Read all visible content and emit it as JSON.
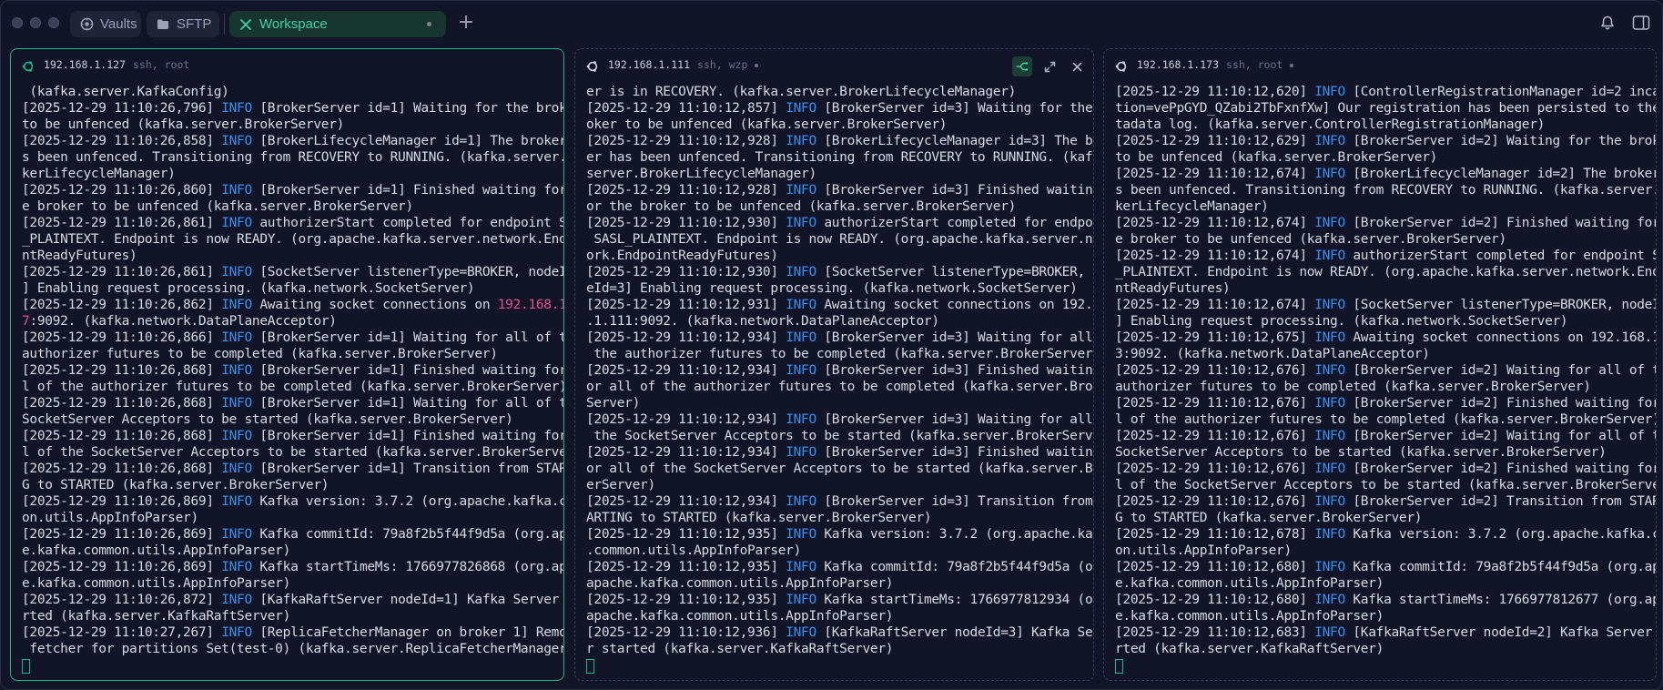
{
  "tabs": [
    {
      "label": "Vaults",
      "icon": "vault-icon"
    },
    {
      "label": "SFTP",
      "icon": "folder-icon"
    },
    {
      "label": "Workspace",
      "icon": "workspace-icon",
      "active": true
    }
  ],
  "colors": {
    "accent": "#1fb585",
    "info": "#3b8ff0",
    "highlight": "#e2508f"
  },
  "panes": [
    {
      "host": "192.168.1.127",
      "conn": "ssh, root",
      "lines": [
        [
          {
            "t": " (kafka.server.KafkaConfig)"
          }
        ],
        [
          {
            "t": "[2025-12-29 11:10:26,796] "
          },
          {
            "t": "INFO",
            "c": "lvl"
          },
          {
            "t": " [BrokerServer id=1] Waiting for the broker"
          }
        ],
        [
          {
            "t": "to be unfenced (kafka.server.BrokerServer)"
          }
        ],
        [
          {
            "t": "[2025-12-29 11:10:26,858] "
          },
          {
            "t": "INFO",
            "c": "lvl"
          },
          {
            "t": " [BrokerLifecycleManager id=1] The broker ha"
          }
        ],
        [
          {
            "t": "s been unfenced. Transitioning from RECOVERY to RUNNING. (kafka.server.Bro"
          }
        ],
        [
          {
            "t": "kerLifecycleManager)"
          }
        ],
        [
          {
            "t": "[2025-12-29 11:10:26,860] "
          },
          {
            "t": "INFO",
            "c": "lvl"
          },
          {
            "t": " [BrokerServer id=1] Finished waiting for th"
          }
        ],
        [
          {
            "t": "e broker to be unfenced (kafka.server.BrokerServer)"
          }
        ],
        [
          {
            "t": "[2025-12-29 11:10:26,861] "
          },
          {
            "t": "INFO",
            "c": "lvl"
          },
          {
            "t": " authorizerStart completed for endpoint SASL"
          }
        ],
        [
          {
            "t": "_PLAINTEXT. Endpoint is now READY. (org.apache.kafka.server.network.Endpoi"
          }
        ],
        [
          {
            "t": "ntReadyFutures)"
          }
        ],
        [
          {
            "t": "[2025-12-29 11:10:26,861] "
          },
          {
            "t": "INFO",
            "c": "lvl"
          },
          {
            "t": " [SocketServer listenerType=BROKER, nodeId=1"
          }
        ],
        [
          {
            "t": "] Enabling request processing. (kafka.network.SocketServer)"
          }
        ],
        [
          {
            "t": "[2025-12-29 11:10:26,862] "
          },
          {
            "t": "INFO",
            "c": "lvl"
          },
          {
            "t": " Awaiting socket connections on "
          },
          {
            "t": "192.168.1.12",
            "c": "hl"
          }
        ],
        [
          {
            "t": "7",
            "c": "hl"
          },
          {
            "t": ":9092. (kafka.network.DataPlaneAcceptor)"
          }
        ],
        [
          {
            "t": "[2025-12-29 11:10:26,866] "
          },
          {
            "t": "INFO",
            "c": "lvl"
          },
          {
            "t": " [BrokerServer id=1] Waiting for all of the"
          }
        ],
        [
          {
            "t": "authorizer futures to be completed (kafka.server.BrokerServer)"
          }
        ],
        [
          {
            "t": "[2025-12-29 11:10:26,868] "
          },
          {
            "t": "INFO",
            "c": "lvl"
          },
          {
            "t": " [BrokerServer id=1] Finished waiting for al"
          }
        ],
        [
          {
            "t": "l of the authorizer futures to be completed (kafka.server.BrokerServer)"
          }
        ],
        [
          {
            "t": "[2025-12-29 11:10:26,868] "
          },
          {
            "t": "INFO",
            "c": "lvl"
          },
          {
            "t": " [BrokerServer id=1] Waiting for all of the"
          }
        ],
        [
          {
            "t": "SocketServer Acceptors to be started (kafka.server.BrokerServer)"
          }
        ],
        [
          {
            "t": "[2025-12-29 11:10:26,868] "
          },
          {
            "t": "INFO",
            "c": "lvl"
          },
          {
            "t": " [BrokerServer id=1] Finished waiting for al"
          }
        ],
        [
          {
            "t": "l of the SocketServer Acceptors to be started (kafka.server.BrokerServer)"
          }
        ],
        [
          {
            "t": "[2025-12-29 11:10:26,868] "
          },
          {
            "t": "INFO",
            "c": "lvl"
          },
          {
            "t": " [BrokerServer id=1] Transition from STARTIN"
          }
        ],
        [
          {
            "t": "G to STARTED (kafka.server.BrokerServer)"
          }
        ],
        [
          {
            "t": "[2025-12-29 11:10:26,869] "
          },
          {
            "t": "INFO",
            "c": "lvl"
          },
          {
            "t": " Kafka version: 3.7.2 (org.apache.kafka.comm"
          }
        ],
        [
          {
            "t": "on.utils.AppInfoParser)"
          }
        ],
        [
          {
            "t": "[2025-12-29 11:10:26,869] "
          },
          {
            "t": "INFO",
            "c": "lvl"
          },
          {
            "t": " Kafka commitId: 79a8f2b5f44f9d5a (org.apach"
          }
        ],
        [
          {
            "t": "e.kafka.common.utils.AppInfoParser)"
          }
        ],
        [
          {
            "t": "[2025-12-29 11:10:26,869] "
          },
          {
            "t": "INFO",
            "c": "lvl"
          },
          {
            "t": " Kafka startTimeMs: 1766977826868 (org.apach"
          }
        ],
        [
          {
            "t": "e.kafka.common.utils.AppInfoParser)"
          }
        ],
        [
          {
            "t": "[2025-12-29 11:10:26,872] "
          },
          {
            "t": "INFO",
            "c": "lvl"
          },
          {
            "t": " [KafkaRaftServer nodeId=1] Kafka Server sta"
          }
        ],
        [
          {
            "t": "rted (kafka.server.KafkaRaftServer)"
          }
        ],
        [
          {
            "t": "[2025-12-29 11:10:27,267] "
          },
          {
            "t": "INFO",
            "c": "lvl"
          },
          {
            "t": " [ReplicaFetcherManager on broker 1] Removed"
          }
        ],
        [
          {
            "t": " fetcher for partitions Set(test-0) (kafka.server.ReplicaFetcherManager)"
          }
        ]
      ]
    },
    {
      "host": "192.168.1.111",
      "conn": "ssh, wzp",
      "lines": [
        [
          {
            "t": "er is in RECOVERY. (kafka.server.BrokerLifecycleManager)"
          }
        ],
        [
          {
            "t": "[2025-12-29 11:10:12,857] "
          },
          {
            "t": "INFO",
            "c": "lvl"
          },
          {
            "t": " [BrokerServer id=3] Waiting for the br"
          }
        ],
        [
          {
            "t": "oker to be unfenced (kafka.server.BrokerServer)"
          }
        ],
        [
          {
            "t": "[2025-12-29 11:10:12,928] "
          },
          {
            "t": "INFO",
            "c": "lvl"
          },
          {
            "t": " [BrokerLifecycleManager id=3] The brok"
          }
        ],
        [
          {
            "t": "er has been unfenced. Transitioning from RECOVERY to RUNNING. (kafka."
          }
        ],
        [
          {
            "t": "server.BrokerLifecycleManager)"
          }
        ],
        [
          {
            "t": "[2025-12-29 11:10:12,928] "
          },
          {
            "t": "INFO",
            "c": "lvl"
          },
          {
            "t": " [BrokerServer id=3] Finished waiting f"
          }
        ],
        [
          {
            "t": "or the broker to be unfenced (kafka.server.BrokerServer)"
          }
        ],
        [
          {
            "t": "[2025-12-29 11:10:12,930] "
          },
          {
            "t": "INFO",
            "c": "lvl"
          },
          {
            "t": " authorizerStart completed for endpoint"
          }
        ],
        [
          {
            "t": " SASL_PLAINTEXT. Endpoint is now READY. (org.apache.kafka.server.netw"
          }
        ],
        [
          {
            "t": "ork.EndpointReadyFutures)"
          }
        ],
        [
          {
            "t": "[2025-12-29 11:10:12,930] "
          },
          {
            "t": "INFO",
            "c": "lvl"
          },
          {
            "t": " [SocketServer listenerType=BROKER, nod"
          }
        ],
        [
          {
            "t": "eId=3] Enabling request processing. (kafka.network.SocketServer)"
          }
        ],
        [
          {
            "t": "[2025-12-29 11:10:12,931] "
          },
          {
            "t": "INFO",
            "c": "lvl"
          },
          {
            "t": " Awaiting socket connections on 192.168"
          }
        ],
        [
          {
            "t": ".1.111:9092. (kafka.network.DataPlaneAcceptor)"
          }
        ],
        [
          {
            "t": "[2025-12-29 11:10:12,934] "
          },
          {
            "t": "INFO",
            "c": "lvl"
          },
          {
            "t": " [BrokerServer id=3] Waiting for all of"
          }
        ],
        [
          {
            "t": " the authorizer futures to be completed (kafka.server.BrokerServer)"
          }
        ],
        [
          {
            "t": "[2025-12-29 11:10:12,934] "
          },
          {
            "t": "INFO",
            "c": "lvl"
          },
          {
            "t": " [BrokerServer id=3] Finished waiting f"
          }
        ],
        [
          {
            "t": "or all of the authorizer futures to be completed (kafka.server.Broker"
          }
        ],
        [
          {
            "t": "Server)"
          }
        ],
        [
          {
            "t": "[2025-12-29 11:10:12,934] "
          },
          {
            "t": "INFO",
            "c": "lvl"
          },
          {
            "t": " [BrokerServer id=3] Waiting for all of"
          }
        ],
        [
          {
            "t": " the SocketServer Acceptors to be started (kafka.server.BrokerServer)"
          }
        ],
        [
          {
            "t": "[2025-12-29 11:10:12,934] "
          },
          {
            "t": "INFO",
            "c": "lvl"
          },
          {
            "t": " [BrokerServer id=3] Finished waiting f"
          }
        ],
        [
          {
            "t": "or all of the SocketServer Acceptors to be started (kafka.server.Brok"
          }
        ],
        [
          {
            "t": "erServer)"
          }
        ],
        [
          {
            "t": "[2025-12-29 11:10:12,934] "
          },
          {
            "t": "INFO",
            "c": "lvl"
          },
          {
            "t": " [BrokerServer id=3] Transition from ST"
          }
        ],
        [
          {
            "t": "ARTING to STARTED (kafka.server.BrokerServer)"
          }
        ],
        [
          {
            "t": "[2025-12-29 11:10:12,935] "
          },
          {
            "t": "INFO",
            "c": "lvl"
          },
          {
            "t": " Kafka version: 3.7.2 (org.apache.kafka"
          }
        ],
        [
          {
            "t": ".common.utils.AppInfoParser)"
          }
        ],
        [
          {
            "t": "[2025-12-29 11:10:12,935] "
          },
          {
            "t": "INFO",
            "c": "lvl"
          },
          {
            "t": " Kafka commitId: 79a8f2b5f44f9d5a (org."
          }
        ],
        [
          {
            "t": "apache.kafka.common.utils.AppInfoParser)"
          }
        ],
        [
          {
            "t": "[2025-12-29 11:10:12,935] "
          },
          {
            "t": "INFO",
            "c": "lvl"
          },
          {
            "t": " Kafka startTimeMs: 1766977812934 (org."
          }
        ],
        [
          {
            "t": "apache.kafka.common.utils.AppInfoParser)"
          }
        ],
        [
          {
            "t": "[2025-12-29 11:10:12,936] "
          },
          {
            "t": "INFO",
            "c": "lvl"
          },
          {
            "t": " [KafkaRaftServer nodeId=3] Kafka Serve"
          }
        ],
        [
          {
            "t": "r started (kafka.server.KafkaRaftServer)"
          }
        ]
      ]
    },
    {
      "host": "192.168.1.173",
      "conn": "ssh, root",
      "lines": [
        [
          {
            "t": "[2025-12-29 11:10:12,620] "
          },
          {
            "t": "INFO",
            "c": "lvl"
          },
          {
            "t": " [ControllerRegistrationManager id=2 incarna"
          }
        ],
        [
          {
            "t": "tion=vePpGYD_QZabi2TbFxnfXw] Our registration has been persisted to the me"
          }
        ],
        [
          {
            "t": "tadata log. (kafka.server.ControllerRegistrationManager)"
          }
        ],
        [
          {
            "t": "[2025-12-29 11:10:12,629] "
          },
          {
            "t": "INFO",
            "c": "lvl"
          },
          {
            "t": " [BrokerServer id=2] Waiting for the broker"
          }
        ],
        [
          {
            "t": "to be unfenced (kafka.server.BrokerServer)"
          }
        ],
        [
          {
            "t": "[2025-12-29 11:10:12,674] "
          },
          {
            "t": "INFO",
            "c": "lvl"
          },
          {
            "t": " [BrokerLifecycleManager id=2] The broker ha"
          }
        ],
        [
          {
            "t": "s been unfenced. Transitioning from RECOVERY to RUNNING. (kafka.server.Bro"
          }
        ],
        [
          {
            "t": "kerLifecycleManager)"
          }
        ],
        [
          {
            "t": "[2025-12-29 11:10:12,674] "
          },
          {
            "t": "INFO",
            "c": "lvl"
          },
          {
            "t": " [BrokerServer id=2] Finished waiting for th"
          }
        ],
        [
          {
            "t": "e broker to be unfenced (kafka.server.BrokerServer)"
          }
        ],
        [
          {
            "t": "[2025-12-29 11:10:12,674] "
          },
          {
            "t": "INFO",
            "c": "lvl"
          },
          {
            "t": " authorizerStart completed for endpoint SASL"
          }
        ],
        [
          {
            "t": "_PLAINTEXT. Endpoint is now READY. (org.apache.kafka.server.network.Endpoi"
          }
        ],
        [
          {
            "t": "ntReadyFutures)"
          }
        ],
        [
          {
            "t": "[2025-12-29 11:10:12,674] "
          },
          {
            "t": "INFO",
            "c": "lvl"
          },
          {
            "t": " [SocketServer listenerType=BROKER, nodeId=2"
          }
        ],
        [
          {
            "t": "] Enabling request processing. (kafka.network.SocketServer)"
          }
        ],
        [
          {
            "t": "[2025-12-29 11:10:12,675] "
          },
          {
            "t": "INFO",
            "c": "lvl"
          },
          {
            "t": " Awaiting socket connections on 192.168.1.17"
          }
        ],
        [
          {
            "t": "3:9092. (kafka.network.DataPlaneAcceptor)"
          }
        ],
        [
          {
            "t": "[2025-12-29 11:10:12,676] "
          },
          {
            "t": "INFO",
            "c": "lvl"
          },
          {
            "t": " [BrokerServer id=2] Waiting for all of the"
          }
        ],
        [
          {
            "t": "authorizer futures to be completed (kafka.server.BrokerServer)"
          }
        ],
        [
          {
            "t": "[2025-12-29 11:10:12,676] "
          },
          {
            "t": "INFO",
            "c": "lvl"
          },
          {
            "t": " [BrokerServer id=2] Finished waiting for al"
          }
        ],
        [
          {
            "t": "l of the authorizer futures to be completed (kafka.server.BrokerServer)"
          }
        ],
        [
          {
            "t": "[2025-12-29 11:10:12,676] "
          },
          {
            "t": "INFO",
            "c": "lvl"
          },
          {
            "t": " [BrokerServer id=2] Waiting for all of the"
          }
        ],
        [
          {
            "t": "SocketServer Acceptors to be started (kafka.server.BrokerServer)"
          }
        ],
        [
          {
            "t": "[2025-12-29 11:10:12,676] "
          },
          {
            "t": "INFO",
            "c": "lvl"
          },
          {
            "t": " [BrokerServer id=2] Finished waiting for al"
          }
        ],
        [
          {
            "t": "l of the SocketServer Acceptors to be started (kafka.server.BrokerServer)"
          }
        ],
        [
          {
            "t": "[2025-12-29 11:10:12,676] "
          },
          {
            "t": "INFO",
            "c": "lvl"
          },
          {
            "t": " [BrokerServer id=2] Transition from STARTIN"
          }
        ],
        [
          {
            "t": "G to STARTED (kafka.server.BrokerServer)"
          }
        ],
        [
          {
            "t": "[2025-12-29 11:10:12,678] "
          },
          {
            "t": "INFO",
            "c": "lvl"
          },
          {
            "t": " Kafka version: 3.7.2 (org.apache.kafka.comm"
          }
        ],
        [
          {
            "t": "on.utils.AppInfoParser)"
          }
        ],
        [
          {
            "t": "[2025-12-29 11:10:12,680] "
          },
          {
            "t": "INFO",
            "c": "lvl"
          },
          {
            "t": " Kafka commitId: 79a8f2b5f44f9d5a (org.apach"
          }
        ],
        [
          {
            "t": "e.kafka.common.utils.AppInfoParser)"
          }
        ],
        [
          {
            "t": "[2025-12-29 11:10:12,680] "
          },
          {
            "t": "INFO",
            "c": "lvl"
          },
          {
            "t": " Kafka startTimeMs: 1766977812677 (org.apach"
          }
        ],
        [
          {
            "t": "e.kafka.common.utils.AppInfoParser)"
          }
        ],
        [
          {
            "t": "[2025-12-29 11:10:12,683] "
          },
          {
            "t": "INFO",
            "c": "lvl"
          },
          {
            "t": " [KafkaRaftServer nodeId=2] Kafka Server sta"
          }
        ],
        [
          {
            "t": "rted (kafka.server.KafkaRaftServer)"
          }
        ]
      ]
    }
  ]
}
